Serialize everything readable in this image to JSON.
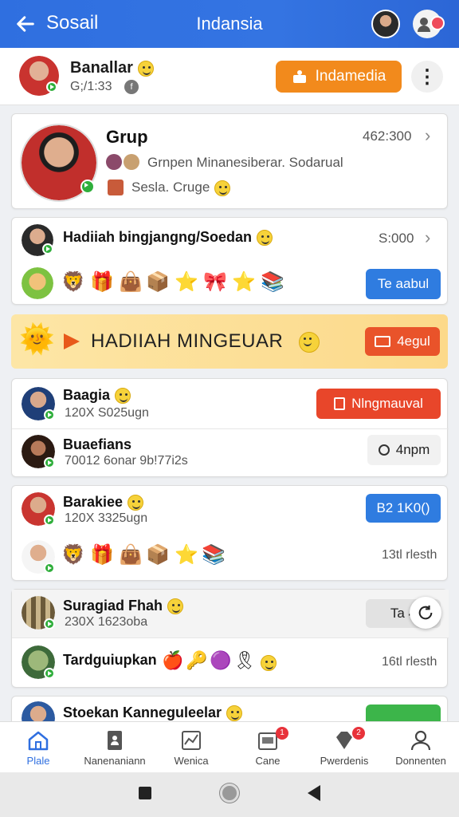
{
  "appbar": {
    "brand": "Sosail",
    "title": "Indansia"
  },
  "profile": {
    "name": "Banallar",
    "sub": "G;/1:33",
    "sub_icon": "f",
    "action": "Indamedia"
  },
  "group": {
    "title": "Grup",
    "count": "462:300",
    "line1": "Grnpen Minanesiberar. Sodarual",
    "line2": "Sesla. Cruge"
  },
  "gift": {
    "title": "Hadiiah bingjangng/Soedan",
    "count": "S:000",
    "button": "Te aabul"
  },
  "banner": {
    "text": "HADIIAH MINGEUAR",
    "button": "4egul"
  },
  "users_a": [
    {
      "name": "Baagia",
      "sub": "120X S025ugn",
      "button": "Nlngmauval"
    },
    {
      "name": "Buaefians",
      "sub": "70012 6onar 9b!77i2s",
      "button": "4npm"
    }
  ],
  "user_b": {
    "name": "Barakiee",
    "sub": "120X 3325ugn",
    "button": "B2 1K0()",
    "meta": "13tl rlesth"
  },
  "users_c": [
    {
      "name": "Suragiad Fhah",
      "sub": "230X 1623oba",
      "button": "Ta 4"
    },
    {
      "name": "Tardguiupkan",
      "meta": "16tl rlesth"
    }
  ],
  "user_d": {
    "name": "Stoekan Kanneguleelar"
  },
  "nav": [
    {
      "label": "Plale"
    },
    {
      "label": "Nanenaniann"
    },
    {
      "label": "Wenica"
    },
    {
      "label": "Cane",
      "badge": "1"
    },
    {
      "label": "Pwerdenis",
      "badge": "2"
    },
    {
      "label": "Donnenten"
    }
  ],
  "colors": {
    "primary": "#2f6fe0",
    "accent_orange": "#f28a1c",
    "accent_red": "#e8462a",
    "online_green": "#2fae3b"
  }
}
